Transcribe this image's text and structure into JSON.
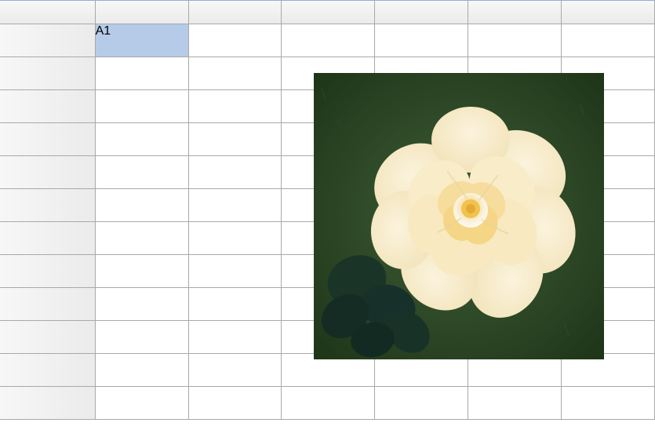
{
  "spreadsheet": {
    "selected_cell": "A1",
    "columns": [
      "",
      "",
      "",
      "",
      "",
      ""
    ],
    "rows": [
      "",
      "",
      "",
      "",
      "",
      "",
      "",
      "",
      "",
      "",
      "",
      ""
    ],
    "headers": {
      "row_header": "",
      "col_corner": ""
    }
  },
  "embedded_image": {
    "description": "yellow-rose-photo",
    "position": {
      "col": "C",
      "row": 2
    }
  }
}
